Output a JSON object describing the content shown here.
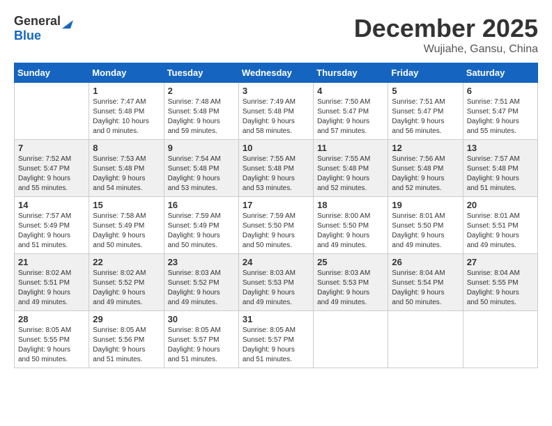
{
  "header": {
    "logo_general": "General",
    "logo_blue": "Blue",
    "month_title": "December 2025",
    "location": "Wujiahe, Gansu, China"
  },
  "calendar": {
    "days_of_week": [
      "Sunday",
      "Monday",
      "Tuesday",
      "Wednesday",
      "Thursday",
      "Friday",
      "Saturday"
    ],
    "weeks": [
      [
        {
          "day": "",
          "info": ""
        },
        {
          "day": "1",
          "info": "Sunrise: 7:47 AM\nSunset: 5:48 PM\nDaylight: 10 hours\nand 0 minutes."
        },
        {
          "day": "2",
          "info": "Sunrise: 7:48 AM\nSunset: 5:48 PM\nDaylight: 9 hours\nand 59 minutes."
        },
        {
          "day": "3",
          "info": "Sunrise: 7:49 AM\nSunset: 5:48 PM\nDaylight: 9 hours\nand 58 minutes."
        },
        {
          "day": "4",
          "info": "Sunrise: 7:50 AM\nSunset: 5:47 PM\nDaylight: 9 hours\nand 57 minutes."
        },
        {
          "day": "5",
          "info": "Sunrise: 7:51 AM\nSunset: 5:47 PM\nDaylight: 9 hours\nand 56 minutes."
        },
        {
          "day": "6",
          "info": "Sunrise: 7:51 AM\nSunset: 5:47 PM\nDaylight: 9 hours\nand 55 minutes."
        }
      ],
      [
        {
          "day": "7",
          "info": "Sunrise: 7:52 AM\nSunset: 5:47 PM\nDaylight: 9 hours\nand 55 minutes."
        },
        {
          "day": "8",
          "info": "Sunrise: 7:53 AM\nSunset: 5:48 PM\nDaylight: 9 hours\nand 54 minutes."
        },
        {
          "day": "9",
          "info": "Sunrise: 7:54 AM\nSunset: 5:48 PM\nDaylight: 9 hours\nand 53 minutes."
        },
        {
          "day": "10",
          "info": "Sunrise: 7:55 AM\nSunset: 5:48 PM\nDaylight: 9 hours\nand 53 minutes."
        },
        {
          "day": "11",
          "info": "Sunrise: 7:55 AM\nSunset: 5:48 PM\nDaylight: 9 hours\nand 52 minutes."
        },
        {
          "day": "12",
          "info": "Sunrise: 7:56 AM\nSunset: 5:48 PM\nDaylight: 9 hours\nand 52 minutes."
        },
        {
          "day": "13",
          "info": "Sunrise: 7:57 AM\nSunset: 5:48 PM\nDaylight: 9 hours\nand 51 minutes."
        }
      ],
      [
        {
          "day": "14",
          "info": "Sunrise: 7:57 AM\nSunset: 5:49 PM\nDaylight: 9 hours\nand 51 minutes."
        },
        {
          "day": "15",
          "info": "Sunrise: 7:58 AM\nSunset: 5:49 PM\nDaylight: 9 hours\nand 50 minutes."
        },
        {
          "day": "16",
          "info": "Sunrise: 7:59 AM\nSunset: 5:49 PM\nDaylight: 9 hours\nand 50 minutes."
        },
        {
          "day": "17",
          "info": "Sunrise: 7:59 AM\nSunset: 5:50 PM\nDaylight: 9 hours\nand 50 minutes."
        },
        {
          "day": "18",
          "info": "Sunrise: 8:00 AM\nSunset: 5:50 PM\nDaylight: 9 hours\nand 49 minutes."
        },
        {
          "day": "19",
          "info": "Sunrise: 8:01 AM\nSunset: 5:50 PM\nDaylight: 9 hours\nand 49 minutes."
        },
        {
          "day": "20",
          "info": "Sunrise: 8:01 AM\nSunset: 5:51 PM\nDaylight: 9 hours\nand 49 minutes."
        }
      ],
      [
        {
          "day": "21",
          "info": "Sunrise: 8:02 AM\nSunset: 5:51 PM\nDaylight: 9 hours\nand 49 minutes."
        },
        {
          "day": "22",
          "info": "Sunrise: 8:02 AM\nSunset: 5:52 PM\nDaylight: 9 hours\nand 49 minutes."
        },
        {
          "day": "23",
          "info": "Sunrise: 8:03 AM\nSunset: 5:52 PM\nDaylight: 9 hours\nand 49 minutes."
        },
        {
          "day": "24",
          "info": "Sunrise: 8:03 AM\nSunset: 5:53 PM\nDaylight: 9 hours\nand 49 minutes."
        },
        {
          "day": "25",
          "info": "Sunrise: 8:03 AM\nSunset: 5:53 PM\nDaylight: 9 hours\nand 49 minutes."
        },
        {
          "day": "26",
          "info": "Sunrise: 8:04 AM\nSunset: 5:54 PM\nDaylight: 9 hours\nand 50 minutes."
        },
        {
          "day": "27",
          "info": "Sunrise: 8:04 AM\nSunset: 5:55 PM\nDaylight: 9 hours\nand 50 minutes."
        }
      ],
      [
        {
          "day": "28",
          "info": "Sunrise: 8:05 AM\nSunset: 5:55 PM\nDaylight: 9 hours\nand 50 minutes."
        },
        {
          "day": "29",
          "info": "Sunrise: 8:05 AM\nSunset: 5:56 PM\nDaylight: 9 hours\nand 51 minutes."
        },
        {
          "day": "30",
          "info": "Sunrise: 8:05 AM\nSunset: 5:57 PM\nDaylight: 9 hours\nand 51 minutes."
        },
        {
          "day": "31",
          "info": "Sunrise: 8:05 AM\nSunset: 5:57 PM\nDaylight: 9 hours\nand 51 minutes."
        },
        {
          "day": "",
          "info": ""
        },
        {
          "day": "",
          "info": ""
        },
        {
          "day": "",
          "info": ""
        }
      ]
    ]
  }
}
